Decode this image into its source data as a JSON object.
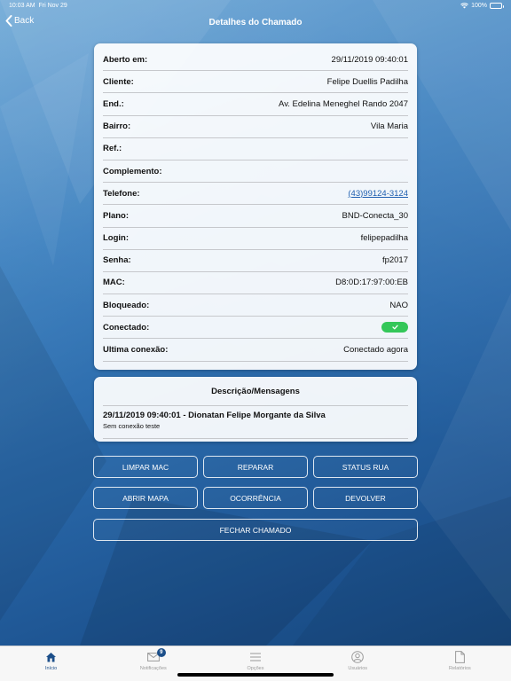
{
  "status_bar": {
    "time": "10:03 AM",
    "date": "Fri Nov 29",
    "battery": "100%"
  },
  "nav": {
    "back_label": "Back",
    "title": "Detalhes do Chamado"
  },
  "details": {
    "rows": [
      {
        "label": "Aberto em:",
        "value": "29/11/2019 09:40:01"
      },
      {
        "label": "Cliente:",
        "value": "Felipe Duellis Padilha"
      },
      {
        "label": "End.:",
        "value": "Av. Edelina Meneghel Rando 2047"
      },
      {
        "label": "Bairro:",
        "value": "Vila Maria"
      },
      {
        "label": "Ref.:",
        "value": ""
      },
      {
        "label": "Complemento:",
        "value": ""
      },
      {
        "label": "Telefone:",
        "value": "(43)99124-3124"
      },
      {
        "label": "Plano:",
        "value": "BND-Conecta_30"
      },
      {
        "label": "Login:",
        "value": "felipepadilha"
      },
      {
        "label": "Senha:",
        "value": "fp2017"
      },
      {
        "label": "MAC:",
        "value": "D8:0D:17:97:00:EB"
      },
      {
        "label": "Bloqueado:",
        "value": "NAO"
      },
      {
        "label": "Conectado:",
        "value": ""
      },
      {
        "label": "Ultima conexão:",
        "value": "Conectado agora"
      }
    ],
    "connected": true,
    "toggle_color": "#34c759"
  },
  "messages": {
    "title": "Descrição/Mensagens",
    "items": [
      {
        "header": "29/11/2019 09:40:01 - Dionatan Felipe Morgante da Silva",
        "body": "Sem conexão teste"
      }
    ]
  },
  "actions": {
    "limpar_mac": "LIMPAR MAC",
    "reparar": "REPARAR",
    "status_rua": "STATUS RUA",
    "abrir_mapa": "ABRIR MAPA",
    "ocorrencia": "OCORRÊNCIA",
    "devolver": "DEVOLVER",
    "fechar_chamado": "FECHAR CHAMADO"
  },
  "tabs": [
    {
      "label": "Início",
      "icon": "home-icon",
      "active": true
    },
    {
      "label": "Notificações",
      "icon": "envelope-icon",
      "badge": "9"
    },
    {
      "label": "Opções",
      "icon": "menu-icon"
    },
    {
      "label": "Usuários",
      "icon": "users-icon"
    },
    {
      "label": "Relatórios",
      "icon": "document-icon"
    }
  ],
  "colors": {
    "accent": "#1c4f8a",
    "background": "#2a69aa"
  }
}
